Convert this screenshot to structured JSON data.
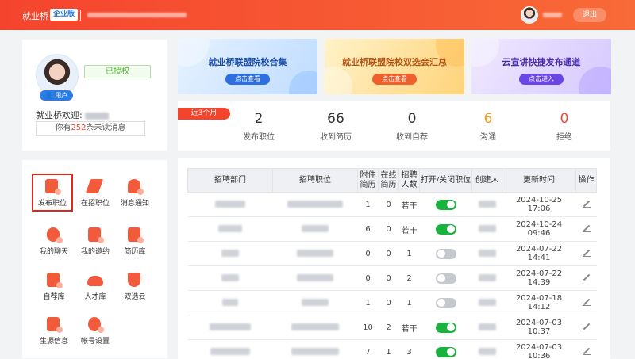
{
  "header": {
    "brand": "就业桥",
    "badge": "企业版",
    "logout_label": "退出"
  },
  "profile": {
    "user_tag": "用户",
    "auth_status": "已授权",
    "welcome": "就业桥欢迎:",
    "unread_prefix": "你有",
    "unread_count": "252",
    "unread_suffix": "条未读消息"
  },
  "banners": [
    {
      "title": "就业桥联盟院校合集",
      "button": "点击查看"
    },
    {
      "title": "就业桥联盟院校双选会汇总",
      "button": "点击查看"
    },
    {
      "title": "云宣讲快捷发布通道",
      "button": "点击进入"
    }
  ],
  "stats": {
    "period": "近3个月",
    "items": [
      {
        "value": "2",
        "label": "发布职位"
      },
      {
        "value": "66",
        "label": "收到简历"
      },
      {
        "value": "0",
        "label": "收到自荐"
      },
      {
        "value": "6",
        "label": "沟通"
      },
      {
        "value": "0",
        "label": "拒绝"
      }
    ]
  },
  "functions": [
    {
      "label": "发布职位",
      "icon": "post-job-icon",
      "active": true
    },
    {
      "label": "在招职位",
      "icon": "paper-plane-icon"
    },
    {
      "label": "消息通知",
      "icon": "bell-icon"
    },
    {
      "label": "我的聊天",
      "icon": "chat-icon"
    },
    {
      "label": "我的邀约",
      "icon": "invite-icon"
    },
    {
      "label": "简历库",
      "icon": "resume-icon"
    },
    {
      "label": "自荐库",
      "icon": "self-rec-icon"
    },
    {
      "label": "人才库",
      "icon": "cloud-icon"
    },
    {
      "label": "双选云",
      "icon": "trophy-icon"
    },
    {
      "label": "生源信息",
      "icon": "book-icon"
    },
    {
      "label": "帐号设置",
      "icon": "settings-icon"
    }
  ],
  "table": {
    "headers": [
      "招聘部门",
      "招聘职位",
      "附件简历",
      "在线简历",
      "招聘人数",
      "打开/关闭职位",
      "创建人",
      "更新时间",
      "操作"
    ],
    "rows": [
      {
        "attach": "1",
        "online": "0",
        "count": "若干",
        "open": true,
        "time": "2024-10-25 17:06"
      },
      {
        "attach": "6",
        "online": "0",
        "count": "若干",
        "open": true,
        "time": "2024-10-24 09:46"
      },
      {
        "attach": "0",
        "online": "0",
        "count": "1",
        "open": false,
        "time": "2024-07-22 14:41"
      },
      {
        "attach": "0",
        "online": "0",
        "count": "2",
        "open": false,
        "time": "2024-07-22 14:39"
      },
      {
        "attach": "1",
        "online": "0",
        "count": "1",
        "open": false,
        "time": "2024-07-18 14:12"
      },
      {
        "attach": "10",
        "online": "2",
        "count": "若干",
        "open": true,
        "time": "2024-07-03 10:37"
      },
      {
        "attach": "7",
        "online": "1",
        "count": "3",
        "open": true,
        "time": "2024-07-03 10:36"
      }
    ]
  },
  "colors": {
    "accent": "#f5442e",
    "toggle_on": "#19b23c",
    "highlight": "#f59a23"
  }
}
